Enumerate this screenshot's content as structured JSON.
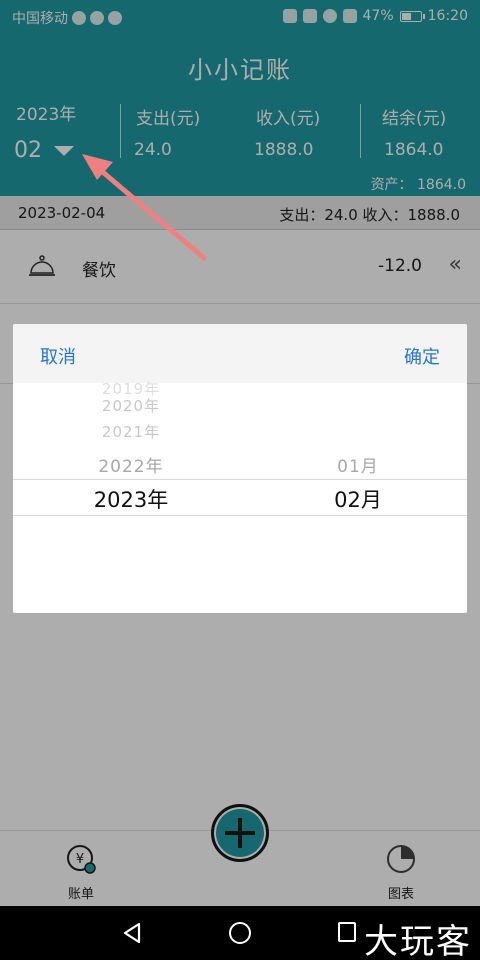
{
  "status_bar": {
    "carrier": "中国移动",
    "battery_percent": "47%",
    "battery_level": 0.47,
    "time": "16:20",
    "icons": [
      "notification-app-icon",
      "wechat-icon",
      "message-icon",
      "mute-icon",
      "hd-icon",
      "wifi-icon",
      "4g-signal-icon",
      "battery-icon"
    ]
  },
  "header": {
    "title": "小小记账",
    "year_label": "2023年",
    "month_value": "02",
    "expense_label": "支出(元)",
    "expense_value": "24.0",
    "income_label": "收入(元)",
    "income_value": "1888.0",
    "balance_label": "结余(元)",
    "balance_value": "1864.0",
    "assets_text": "资产：  1864.0"
  },
  "day_summary": {
    "date": "2023-02-04",
    "summary": "支出：24.0 收入：1888.0"
  },
  "records": [
    {
      "icon": "dining-bell-icon",
      "category": "餐饮",
      "amount": "-12.0"
    }
  ],
  "picker_dialog": {
    "cancel_label": "取消",
    "confirm_label": "确定",
    "years": [
      "2019年",
      "2020年",
      "2021年",
      "2022年",
      "2023年"
    ],
    "months": [
      "01月",
      "02月"
    ],
    "selected_year": "2023年",
    "selected_month": "02月"
  },
  "bottom_nav": {
    "bill_label": "账单",
    "chart_label": "图表"
  },
  "watermark": "大玩客",
  "colors": {
    "primary": "#1f9aa1",
    "link_blue": "#2575d6",
    "arrow": "#f08080"
  }
}
